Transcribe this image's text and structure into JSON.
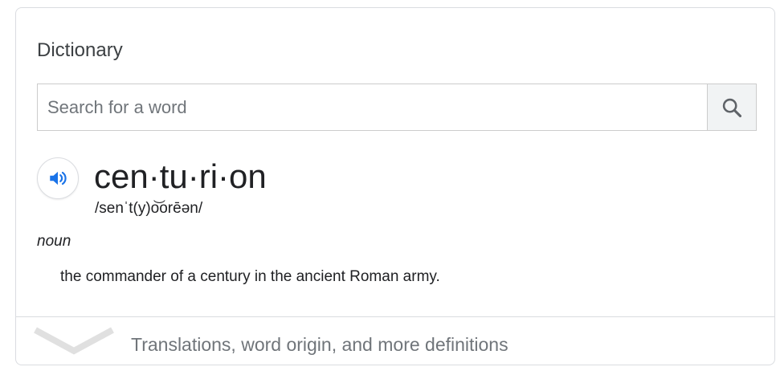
{
  "card": {
    "title": "Dictionary"
  },
  "search": {
    "placeholder": "Search for a word",
    "value": "",
    "button_icon": "search-icon"
  },
  "entry": {
    "audio_icon": "speaker-icon",
    "headword": "cen·tu·ri·on",
    "phonetic": "/senˈt(y)o͝orēən/",
    "part_of_speech": "noun",
    "definition": "the commander of a century in the ancient Roman army."
  },
  "footer": {
    "icon": "chevron-down-icon",
    "label": "Translations, word origin, and more definitions"
  },
  "colors": {
    "accent_blue": "#1a73e8",
    "border": "#dadce0",
    "secondary_text": "#70757a",
    "chevron": "#dadce0"
  }
}
